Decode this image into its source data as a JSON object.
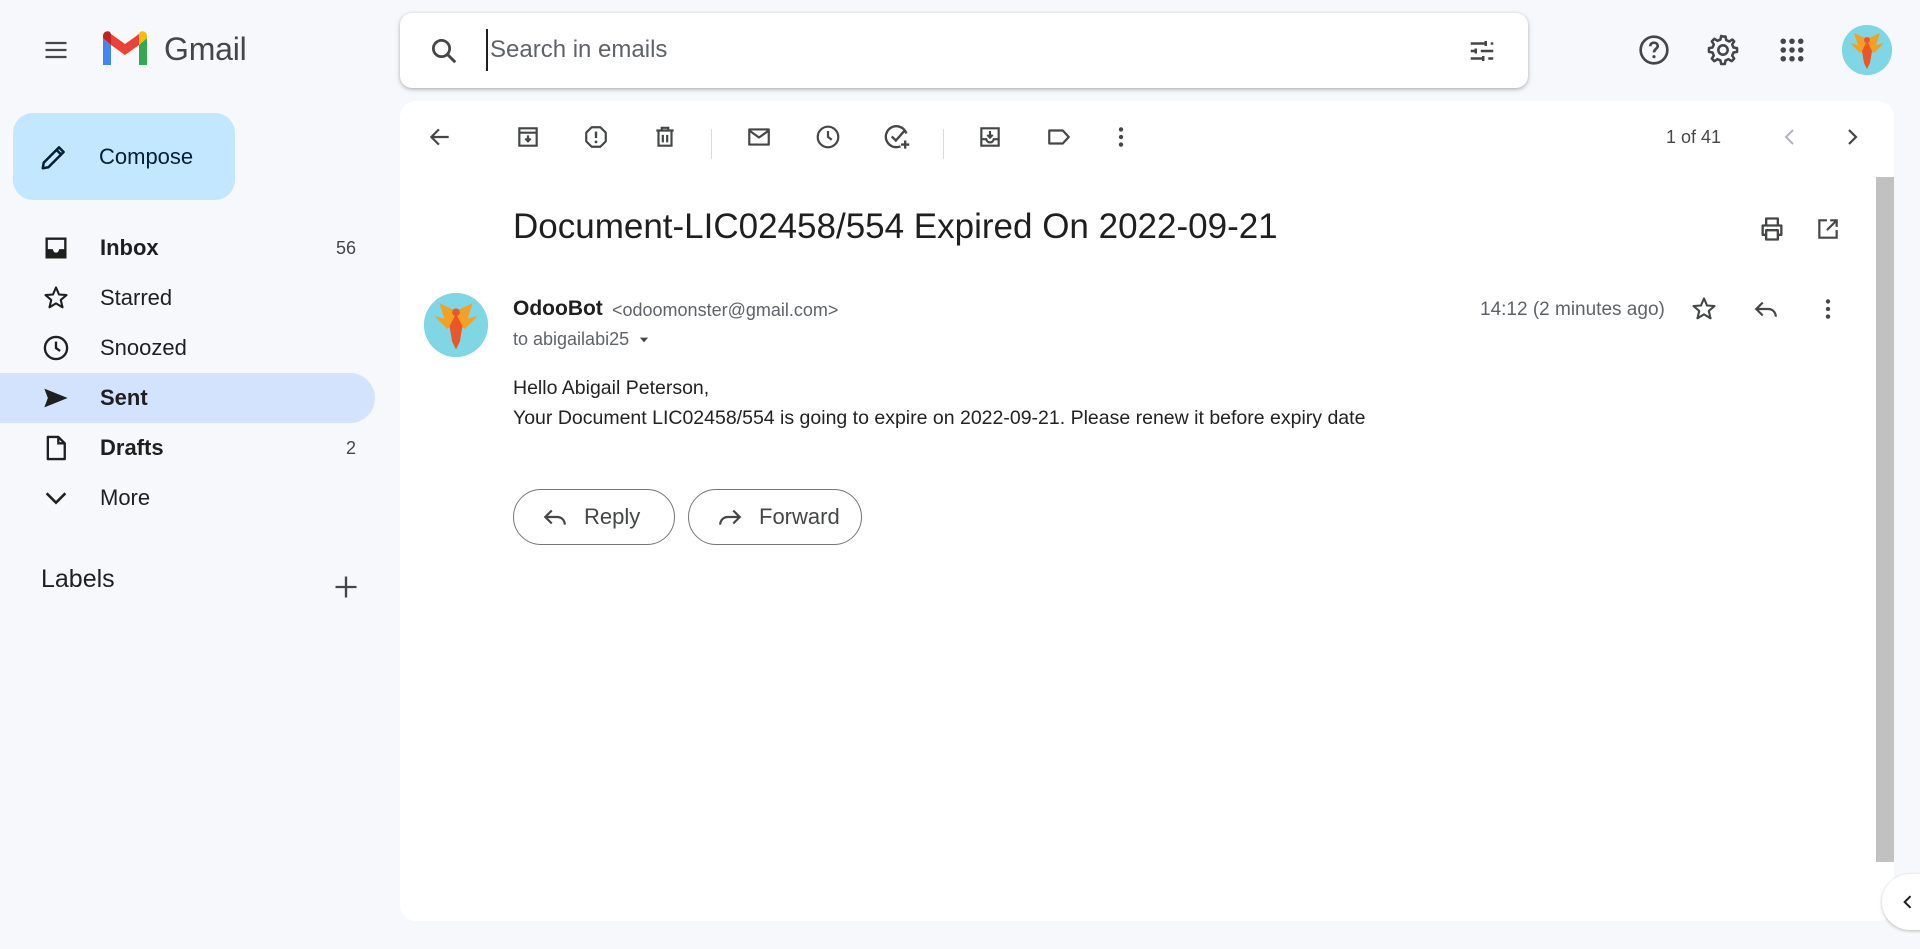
{
  "app": {
    "name": "Gmail"
  },
  "search": {
    "placeholder": "Search in emails"
  },
  "sidebar": {
    "compose_label": "Compose",
    "items": [
      {
        "label": "Inbox",
        "count": "56",
        "bold": true
      },
      {
        "label": "Starred",
        "count": ""
      },
      {
        "label": "Snoozed",
        "count": ""
      },
      {
        "label": "Sent",
        "count": "",
        "active": true
      },
      {
        "label": "Drafts",
        "count": "2",
        "bold": true
      },
      {
        "label": "More",
        "count": ""
      }
    ],
    "labels_heading": "Labels"
  },
  "toolbar": {
    "pager": "1 of 41"
  },
  "email": {
    "subject": "Document-LIC02458/554 Expired On 2022-09-21",
    "sender_name": "OdooBot",
    "sender_email": "<odoomonster@gmail.com>",
    "to": "to abigailabi25",
    "time": "14:12 (2 minutes ago)",
    "body_line1": "Hello Abigail Peterson,",
    "body_line2": "Your Document LIC02458/554 is going to expire on 2022-09-21. Please renew it before expiry date",
    "reply_label": "Reply",
    "forward_label": "Forward"
  },
  "colors": {
    "accent": "#c2e7ff",
    "active_nav": "#d3e3fd",
    "background": "#f6f8fc"
  }
}
